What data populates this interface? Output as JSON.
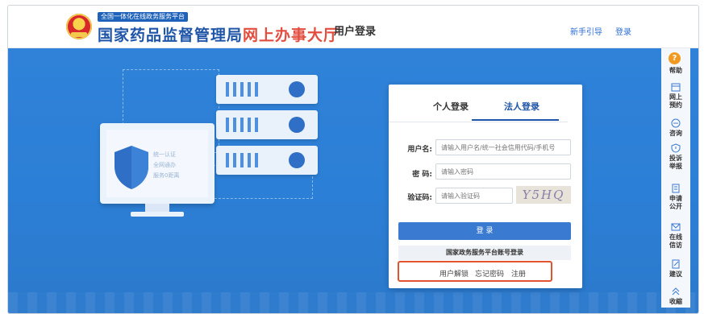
{
  "header": {
    "platform_tag": "全国一体化在线政务服务平台",
    "brand_main": "国家药品监督管理局",
    "brand_sub": "网上办事大厅",
    "page_heading": "用户登录",
    "nav_guide": "新手引导",
    "nav_login": "登录"
  },
  "illustration": {
    "line1": "统一认证",
    "line2": "全网通办",
    "line3": "服务0距离"
  },
  "login": {
    "tabs": [
      "个人登录",
      "法人登录"
    ],
    "active_tab": "法人登录",
    "username_label": "用户名:",
    "username_placeholder": "请输入用户名/统一社会信用代码/手机号",
    "password_label": "密 码:",
    "password_placeholder": "请输入密码",
    "captcha_label": "验证码:",
    "captcha_placeholder": "请输入验证码",
    "captcha_text": "Y5HQ",
    "login_button": "登 录",
    "alt_login": "国家政务服务平台账号登录",
    "links": {
      "unlock": "用户解锁",
      "forgot": "忘记密码",
      "register": "注册"
    }
  },
  "sidebar": {
    "items": [
      {
        "label": "帮助",
        "icon": "help-icon"
      },
      {
        "label": "网上预约",
        "icon": "calendar-icon"
      },
      {
        "label": "咨询",
        "icon": "chat-icon"
      },
      {
        "label": "投诉举报",
        "icon": "alert-icon"
      },
      {
        "label": "申请公开",
        "icon": "document-icon"
      },
      {
        "label": "在线信访",
        "icon": "mail-icon"
      },
      {
        "label": "建议",
        "icon": "edit-icon"
      },
      {
        "label": "收縮",
        "icon": "collapse-icon"
      }
    ]
  },
  "colors": {
    "brand_blue": "#1f55a8",
    "brand_red": "#e34d3f",
    "banner_blue": "#2f82d8",
    "highlight": "#e2532f"
  }
}
